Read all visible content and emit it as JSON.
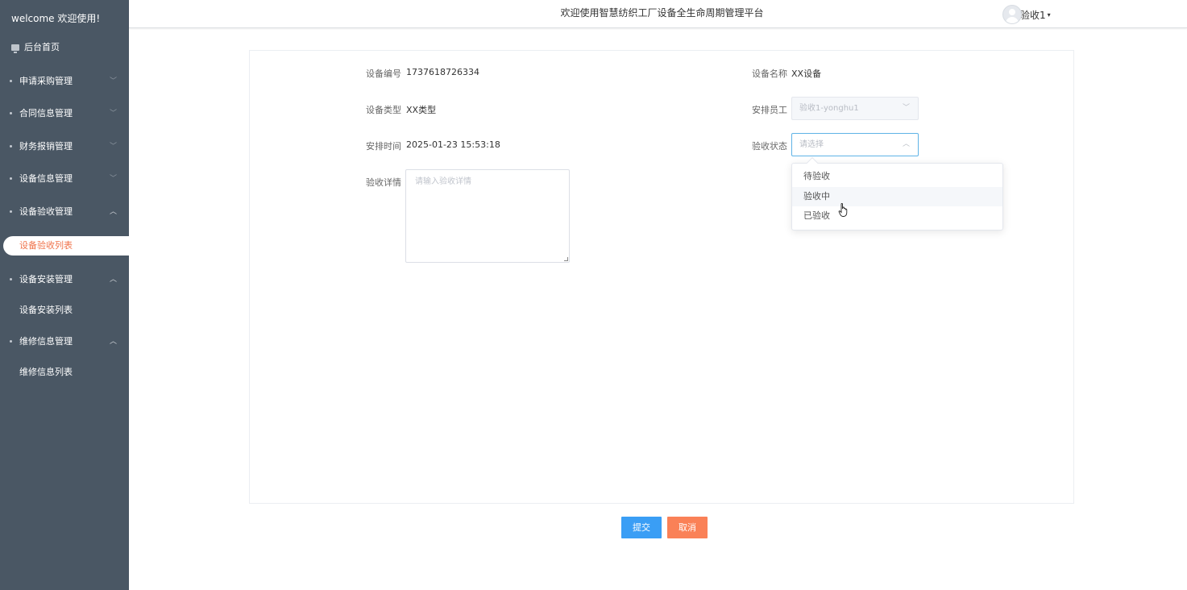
{
  "sidebar": {
    "welcome": "welcome 欢迎使用!",
    "home": "后台首页",
    "groups": [
      {
        "label": "申请采购管理"
      },
      {
        "label": "合同信息管理"
      },
      {
        "label": "财务报销管理"
      },
      {
        "label": "设备信息管理"
      },
      {
        "label": "设备验收管理"
      },
      {
        "label": "设备安装管理"
      },
      {
        "label": "维修信息管理"
      }
    ],
    "subitems": {
      "acceptance_list": "设备验收列表",
      "install_list": "设备安装列表",
      "repair_list": "维修信息列表"
    },
    "colors": {
      "background": "#4a5764",
      "active_text": "#f0734b"
    }
  },
  "header": {
    "title": "欢迎使用智慧纺织工厂设备全生命周期管理平台",
    "user_name": "验收1"
  },
  "form": {
    "device_no_label": "设备编号",
    "device_no": "1737618726334",
    "device_name_label": "设备名称",
    "device_name": "XX设备",
    "device_type_label": "设备类型",
    "device_type": "XX类型",
    "staff_label": "安排员工",
    "staff_value": "验收1-yonghu1",
    "time_label": "安排时间",
    "time_value": "2025-01-23 15:53:18",
    "status_label": "验收状态",
    "status_placeholder": "请选择",
    "detail_label": "验收详情",
    "detail_placeholder": "请输入验收详情"
  },
  "status_options": [
    "待验收",
    "验收中",
    "已验收"
  ],
  "status_hovered": "验收中",
  "buttons": {
    "submit": "提交",
    "cancel": "取消",
    "colors": {
      "submit": "#3a9ef5",
      "cancel": "#fa8157"
    }
  }
}
